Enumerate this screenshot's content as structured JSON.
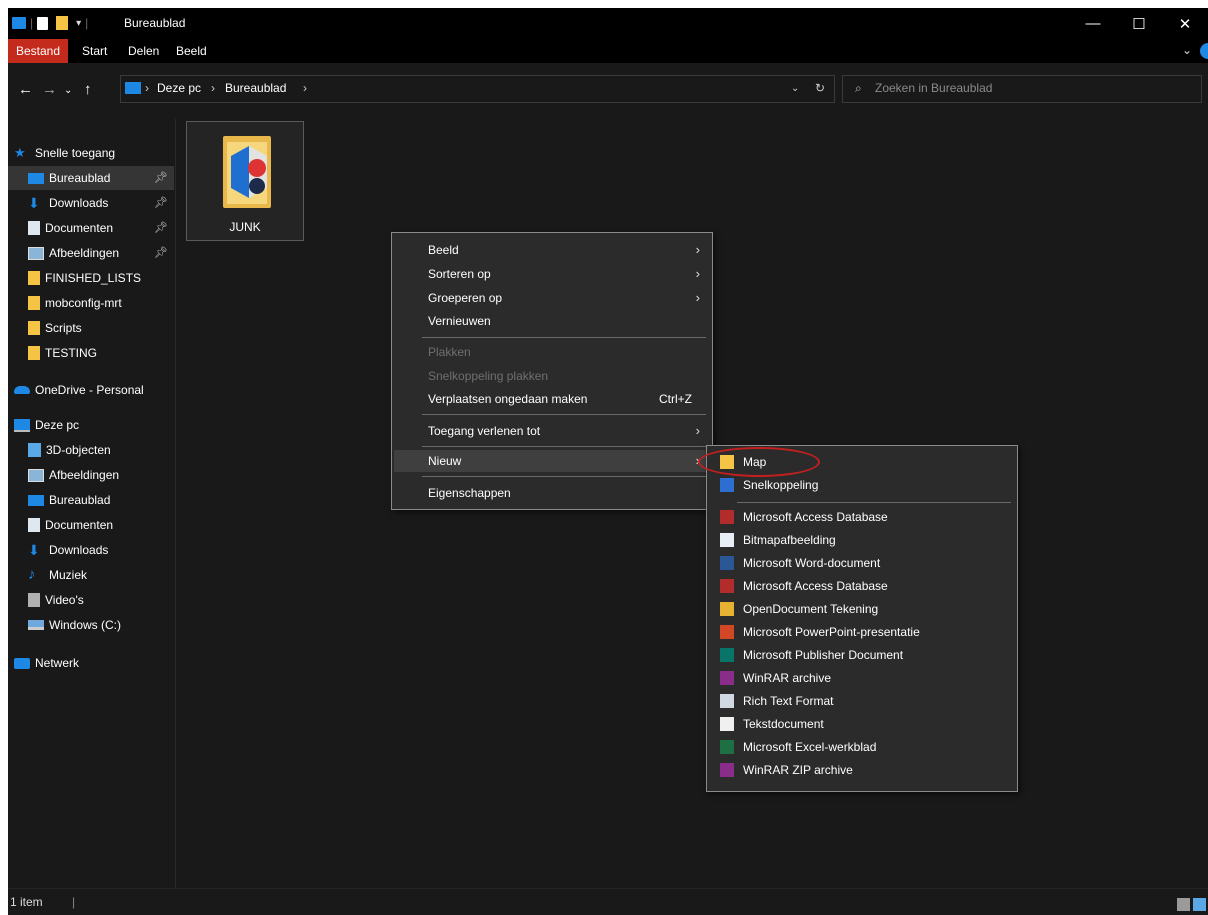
{
  "window": {
    "title": "Bureaublad"
  },
  "ribbon": {
    "tabs": [
      "Bestand",
      "Start",
      "Delen",
      "Beeld"
    ]
  },
  "address": {
    "crumbs": [
      "Deze pc",
      "Bureaublad"
    ],
    "search_placeholder": "Zoeken in Bureaublad"
  },
  "nav": {
    "items": [
      {
        "label": "Snelle toegang",
        "icon": "star-icon"
      },
      {
        "label": "Bureaublad",
        "icon": "desktop-icon",
        "pinned": true,
        "selected": true
      },
      {
        "label": "Downloads",
        "icon": "download-icon",
        "pinned": true
      },
      {
        "label": "Documenten",
        "icon": "document-icon",
        "pinned": true
      },
      {
        "label": "Afbeeldingen",
        "icon": "pictures-icon",
        "pinned": true
      },
      {
        "label": "FINISHED_LISTS",
        "icon": "folder-icon"
      },
      {
        "label": "mobconfig-mrt",
        "icon": "folder-icon"
      },
      {
        "label": "Scripts",
        "icon": "folder-icon"
      },
      {
        "label": "TESTING",
        "icon": "folder-icon"
      },
      {
        "label": "OneDrive - Personal",
        "icon": "cloud-icon"
      },
      {
        "label": "Deze pc",
        "icon": "computer-icon"
      },
      {
        "label": "3D-objecten",
        "icon": "cube-icon"
      },
      {
        "label": "Afbeeldingen",
        "icon": "pictures-icon"
      },
      {
        "label": "Bureaublad",
        "icon": "desktop-icon"
      },
      {
        "label": "Documenten",
        "icon": "document-icon"
      },
      {
        "label": "Downloads",
        "icon": "download-icon"
      },
      {
        "label": "Muziek",
        "icon": "music-icon"
      },
      {
        "label": "Video's",
        "icon": "video-icon"
      },
      {
        "label": "Windows (C:)",
        "icon": "drive-icon"
      },
      {
        "label": "Netwerk",
        "icon": "network-icon"
      }
    ]
  },
  "content": {
    "files": [
      {
        "name": "JUNK"
      }
    ]
  },
  "status": {
    "count": "1 item"
  },
  "context_menu": {
    "items": [
      {
        "label": "Beeld",
        "submenu": true
      },
      {
        "label": "Sorteren op",
        "submenu": true
      },
      {
        "label": "Groeperen op",
        "submenu": true
      },
      {
        "label": "Vernieuwen"
      },
      {
        "label": "Plakken",
        "disabled": true
      },
      {
        "label": "Snelkoppeling plakken",
        "disabled": true
      },
      {
        "label": "Verplaatsen ongedaan maken",
        "shortcut": "Ctrl+Z"
      },
      {
        "label": "Toegang verlenen tot",
        "submenu": true
      },
      {
        "label": "Nieuw",
        "submenu": true,
        "highlighted": true
      },
      {
        "label": "Eigenschappen"
      }
    ]
  },
  "submenu": {
    "items": [
      {
        "label": "Map",
        "icon": "folder-icon"
      },
      {
        "label": "Snelkoppeling",
        "icon": "shortcut-icon"
      },
      {
        "label": "Microsoft Access Database",
        "icon": "access-icon"
      },
      {
        "label": "Bitmapafbeelding",
        "icon": "bitmap-icon"
      },
      {
        "label": "Microsoft Word-document",
        "icon": "word-icon"
      },
      {
        "label": "Microsoft Access Database",
        "icon": "access-icon"
      },
      {
        "label": "OpenDocument Tekening",
        "icon": "draw-icon"
      },
      {
        "label": "Microsoft PowerPoint-presentatie",
        "icon": "powerpoint-icon"
      },
      {
        "label": "Microsoft Publisher Document",
        "icon": "publisher-icon"
      },
      {
        "label": "WinRAR archive",
        "icon": "winrar-icon"
      },
      {
        "label": "Rich Text Format",
        "icon": "rtf-icon"
      },
      {
        "label": "Tekstdocument",
        "icon": "text-icon"
      },
      {
        "label": "Microsoft Excel-werkblad",
        "icon": "excel-icon"
      },
      {
        "label": "WinRAR ZIP archive",
        "icon": "winrar-icon"
      }
    ]
  },
  "colors": {
    "accent": "#c42b1c",
    "background": "#191919",
    "menu": "#2b2b2b",
    "annotation": "#c21f1f"
  }
}
